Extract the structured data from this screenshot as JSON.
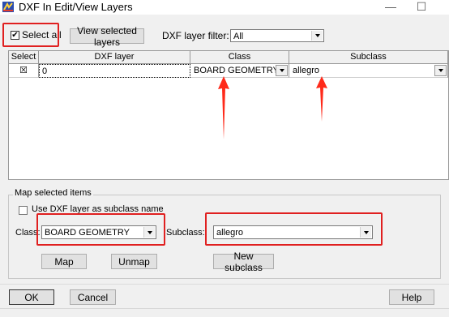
{
  "window": {
    "title": "DXF In Edit/View Layers",
    "minimize_glyph": "—",
    "maximize_glyph": "☐"
  },
  "toolbar": {
    "select_all_label": "Select all",
    "select_all_checked": true,
    "view_selected_label": "View selected layers",
    "filter_label": "DXF layer filter:",
    "filter_value": "All"
  },
  "grid": {
    "columns": [
      "Select",
      "DXF layer",
      "Class",
      "Subclass"
    ],
    "rows": [
      {
        "selected_mark": "☒",
        "dxf_layer": "0",
        "class": "BOARD GEOMETRY",
        "subclass": "allegro"
      }
    ]
  },
  "map_group": {
    "title": "Map selected items",
    "use_dxf_label": "Use DXF layer as subclass name",
    "use_dxf_checked": false,
    "class_label": "Class:",
    "class_value": "BOARD GEOMETRY",
    "subclass_label": "Subclass:",
    "subclass_value": "allegro",
    "map_button": "Map",
    "unmap_button": "Unmap",
    "new_subclass_button": "New subclass"
  },
  "footer": {
    "ok_label": "OK",
    "cancel_label": "Cancel",
    "help_label": "Help"
  },
  "colors": {
    "highlight_red": "#e02020",
    "annotation_arrow": "#ff2a1a"
  }
}
